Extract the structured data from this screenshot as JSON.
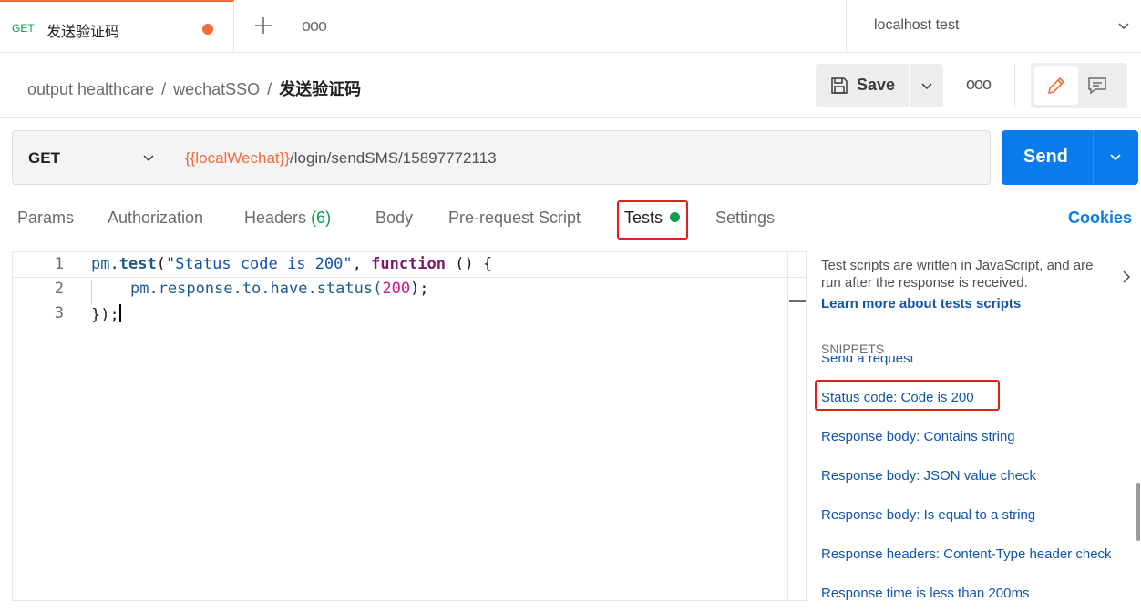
{
  "tab": {
    "method": "GET",
    "title": "发送验证码",
    "more": "ooo"
  },
  "environment": {
    "selected": "localhost test"
  },
  "breadcrumb": {
    "workspace": "output healthcare",
    "collection": "wechatSSO",
    "request": "发送验证码",
    "separator": "/"
  },
  "toolbar": {
    "save_label": "Save",
    "more": "ooo"
  },
  "request": {
    "method": "GET",
    "url_variable": "{{localWechat}}",
    "url_path": "/login/sendSMS/15897772113",
    "send_label": "Send"
  },
  "request_tabs": {
    "params": "Params",
    "authorization": "Authorization",
    "headers": "Headers",
    "headers_count": "(6)",
    "body": "Body",
    "prerequest": "Pre-request Script",
    "tests": "Tests",
    "settings": "Settings",
    "cookies": "Cookies"
  },
  "editor": {
    "line_numbers": [
      "1",
      "2",
      "3"
    ],
    "line1": {
      "obj": "pm",
      "dot": ".",
      "fn": "test",
      "p1": "(",
      "str": "\"Status code is 200\"",
      "p2": ", ",
      "kw": "function",
      "p3": " () {"
    },
    "line2": {
      "code": "pm.response.to.have.status(",
      "num": "200",
      "end": ");"
    },
    "line3": {
      "code": "});"
    }
  },
  "snippets": {
    "description": "Test scripts are written in JavaScript, and are run after the response is received.",
    "learn_more": "Learn more about tests scripts",
    "heading": "SNIPPETS",
    "items": [
      "Send a request",
      "Status code: Code is 200",
      "Response body: Contains string",
      "Response body: JSON value check",
      "Response body: Is equal to a string",
      "Response headers: Content-Type header check",
      "Response time is less than 200ms"
    ]
  },
  "colors": {
    "accent": "#097bed",
    "modified_dot": "#f26b3a",
    "get_method": "#0c9c4b",
    "highlight_box": "#e0201c"
  }
}
